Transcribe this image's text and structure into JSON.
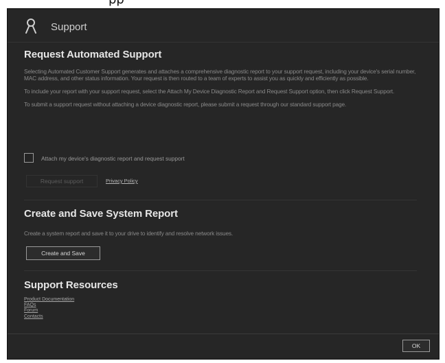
{
  "top_text": "pp",
  "dialog": {
    "title": "Support",
    "icon": "user-icon"
  },
  "automated": {
    "heading": "Request Automated Support",
    "para1": "Selecting Automated Customer Support generates and attaches a comprehensive diagnostic report to your support request, including your device's serial number, MAC address, and other status information. Your request is then routed to a team of experts to assist you as quickly and efficiently as possible.",
    "para2": "To include your report with your support request, select the Attach My Device Diagnostic Report and Request Support option, then click Request Support.",
    "para3": "To submit a support request without attaching a device diagnostic report, please submit a request through our standard support page.",
    "checkbox_label": "Attach my device's diagnostic report and request support",
    "checkbox_checked": false,
    "request_button": "Request support",
    "privacy_link": "Privacy Policy"
  },
  "system_report": {
    "heading": "Create and Save System Report",
    "description": "Create a system report and save it to your drive to identify and resolve network issues.",
    "button": "Create and Save"
  },
  "resources": {
    "heading": "Support Resources",
    "links": [
      "Product Documentation",
      "FAQs",
      "Forum",
      "Contacts"
    ]
  },
  "footer": {
    "ok_label": "OK"
  },
  "colors": {
    "dialog_bg": "#262626",
    "heading": "#e6e6e6",
    "body_text": "#8a8a8a"
  }
}
